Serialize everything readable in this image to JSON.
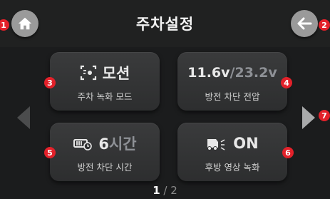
{
  "header": {
    "title": "주차설정"
  },
  "badges": {
    "home": "1",
    "back": "2",
    "motion": "3",
    "voltage": "4",
    "time": "5",
    "rear": "6",
    "next": "7"
  },
  "cards": {
    "parking_mode": {
      "value": "모션",
      "label": "주차 녹화 모드"
    },
    "cutoff_voltage": {
      "value_a": "11.6v",
      "sep": "/",
      "value_b": "23.2v",
      "label": "방전 차단 전압"
    },
    "cutoff_time": {
      "value_num": "6",
      "value_unit": "시간",
      "label": "방전 차단 시간"
    },
    "rear_recording": {
      "value": "ON",
      "label": "후방 영상 녹화"
    }
  },
  "pager": {
    "current": "1",
    "rest": " / 2"
  },
  "icons": {
    "home": "home-icon",
    "back": "back-arrow-icon",
    "motion": "motion-detect-icon",
    "battery": "battery-timer-icon",
    "rear": "rear-camera-icon"
  },
  "colors": {
    "badge": "#e3212a",
    "dim_text": "#8e9196",
    "background": "#1b1c1d"
  }
}
